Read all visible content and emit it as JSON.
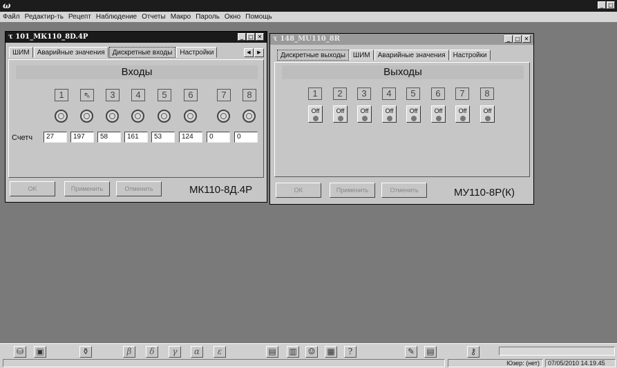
{
  "app": {
    "logo": "ω"
  },
  "menu": [
    "Файл",
    "Редактир-ть",
    "Рецепт",
    "Наблюдение",
    "Отчеты",
    "Макро",
    "Пароль",
    "Окно",
    "Помощь"
  ],
  "win1": {
    "title": "101_МК110_8D.4P",
    "tabs": [
      "ШИМ",
      "Аварийные значения",
      "Дискретные входы",
      "Настройки"
    ],
    "selected_tab": "Дискретные входы",
    "heading": "Входы",
    "channels": [
      "1",
      "2",
      "3",
      "4",
      "5",
      "6",
      "7",
      "8"
    ],
    "count_label": "Счетч",
    "counts": [
      "27",
      "197",
      "58",
      "161",
      "53",
      "124",
      "0",
      "0"
    ],
    "buttons": {
      "ok": "OK",
      "apply": "Применить",
      "cancel": "Отменить"
    },
    "model": "МК110-8Д.4Р"
  },
  "win2": {
    "title": "148_MU110_8R",
    "tabs": [
      "Дискретные выходы",
      "ШИМ",
      "Аварийные значения",
      "Настройки"
    ],
    "selected_tab": "Дискретные выходы",
    "heading": "Выходы",
    "channels": [
      "1",
      "2",
      "3",
      "4",
      "5",
      "6",
      "7",
      "8"
    ],
    "outputs": [
      "Off",
      "Off",
      "Off",
      "Off",
      "Off",
      "Off",
      "Off",
      "Off"
    ],
    "buttons": {
      "ok": "OK",
      "apply": "Применить",
      "cancel": "Отменить"
    },
    "model": "МУ110-8Р(К)"
  },
  "toolbar": [
    {
      "icon": "cylinder-icon"
    },
    {
      "icon": "cube-icon"
    },
    {
      "icon": "flask-icon"
    },
    {
      "icon": "beta-icon",
      "glyph": "β"
    },
    {
      "icon": "delta-icon",
      "glyph": "δ"
    },
    {
      "icon": "gamma-icon",
      "glyph": "γ"
    },
    {
      "icon": "alpha-icon",
      "glyph": "α"
    },
    {
      "icon": "epsilon-icon",
      "glyph": "ε"
    },
    {
      "icon": "book-icon"
    },
    {
      "icon": "books-icon"
    },
    {
      "icon": "person-icon"
    },
    {
      "icon": "grid-icon"
    },
    {
      "icon": "help-icon"
    },
    {
      "icon": "edit-icon"
    },
    {
      "icon": "calculator-icon"
    },
    {
      "icon": "key-icon"
    }
  ],
  "status": {
    "user": "Юзер: (нет)",
    "datetime": "07/05/2010 14.19.45"
  }
}
